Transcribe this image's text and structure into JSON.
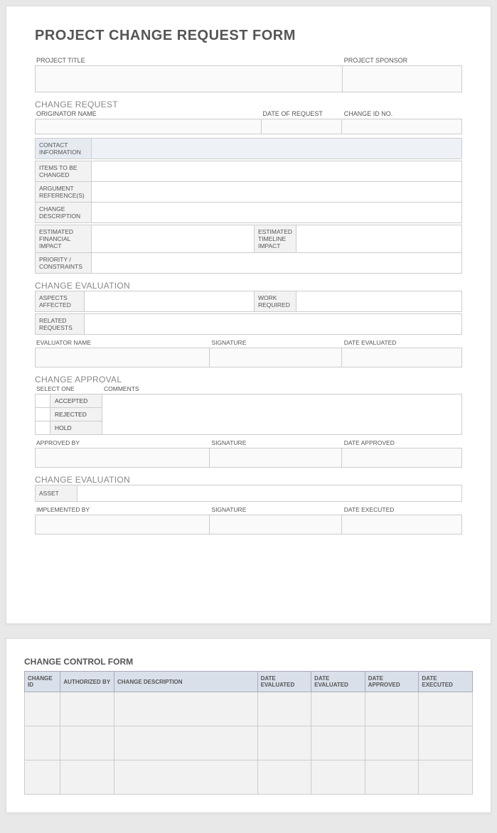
{
  "title": "PROJECT CHANGE REQUEST FORM",
  "top": {
    "project_title_label": "PROJECT TITLE",
    "project_sponsor_label": "PROJECT SPONSOR"
  },
  "change_request": {
    "section": "CHANGE REQUEST",
    "originator_label": "ORIGINATOR NAME",
    "date_label": "DATE OF REQUEST",
    "changeid_label": "CHANGE ID NO.",
    "rows": {
      "contact": "CONTACT INFORMATION",
      "items": "ITEMS TO BE CHANGED",
      "argument": "ARGUMENT REFERENCE(S)",
      "desc": "CHANGE DESCRIPTION",
      "fin": "ESTIMATED FINANCIAL IMPACT",
      "timeline": "ESTIMATED TIMELINE IMPACT",
      "priority": "PRIORITY / CONSTRAINTS"
    }
  },
  "evaluation": {
    "section": "CHANGE EVALUATION",
    "aspects": "ASPECTS AFFECTED",
    "work": "WORK REQUIRED",
    "related": "RELATED REQUESTS",
    "evaluator_label": "EVALUATOR NAME",
    "signature_label": "SIGNATURE",
    "date_label": "DATE EVALUATED"
  },
  "approval": {
    "section": "CHANGE APPROVAL",
    "select_label": "SELECT ONE",
    "comments_label": "COMMENTS",
    "options": {
      "accepted": "ACCEPTED",
      "rejected": "REJECTED",
      "hold": "HOLD"
    },
    "approved_by_label": "APPROVED BY",
    "signature_label": "SIGNATURE",
    "date_label": "DATE APPROVED"
  },
  "implementation": {
    "section": "CHANGE EVALUATION",
    "asset": "ASSET",
    "implemented_by_label": "IMPLEMENTED BY",
    "signature_label": "SIGNATURE",
    "date_label": "DATE EXECUTED"
  },
  "control": {
    "title": "CHANGE CONTROL FORM",
    "headers": {
      "id": "CHANGE ID",
      "auth": "AUTHORIZED BY",
      "desc": "CHANGE DESCRIPTION",
      "eval1": "DATE EVALUATED",
      "eval2": "DATE EVALUATED",
      "approved": "DATE APPROVED",
      "executed": "DATE EXECUTED"
    }
  }
}
